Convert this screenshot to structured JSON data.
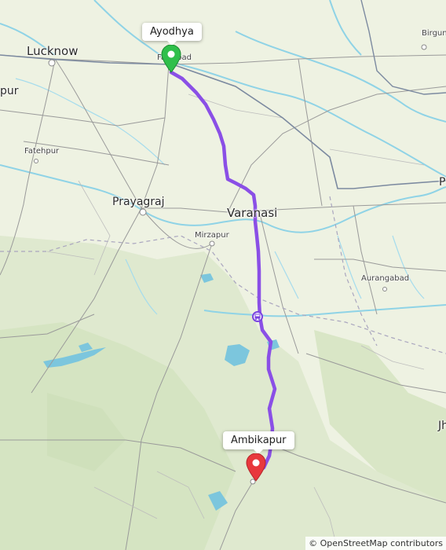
{
  "map": {
    "route_color": "#8a4fe6",
    "origin_color": "#2fbf4a",
    "destination_color": "#e8383d",
    "origin": {
      "label": "Ayodhya"
    },
    "destination": {
      "label": "Ambikapur"
    },
    "cities": {
      "lucknow": "Lucknow",
      "faizabad": "Faizabad",
      "prayagraj": "Prayagraj",
      "varanasi": "Varanasi",
      "fatehpur": "Fatehpur",
      "mirzapur": "Mirzapur",
      "aurangabad": "Aurangabad",
      "birgunj": "Birgun",
      "left_cut": "pur",
      "right_cut_p": "P",
      "right_cut_jh": "Jh"
    },
    "stop_icon": "bus-icon",
    "attribution": "© OpenStreetMap contributors"
  }
}
